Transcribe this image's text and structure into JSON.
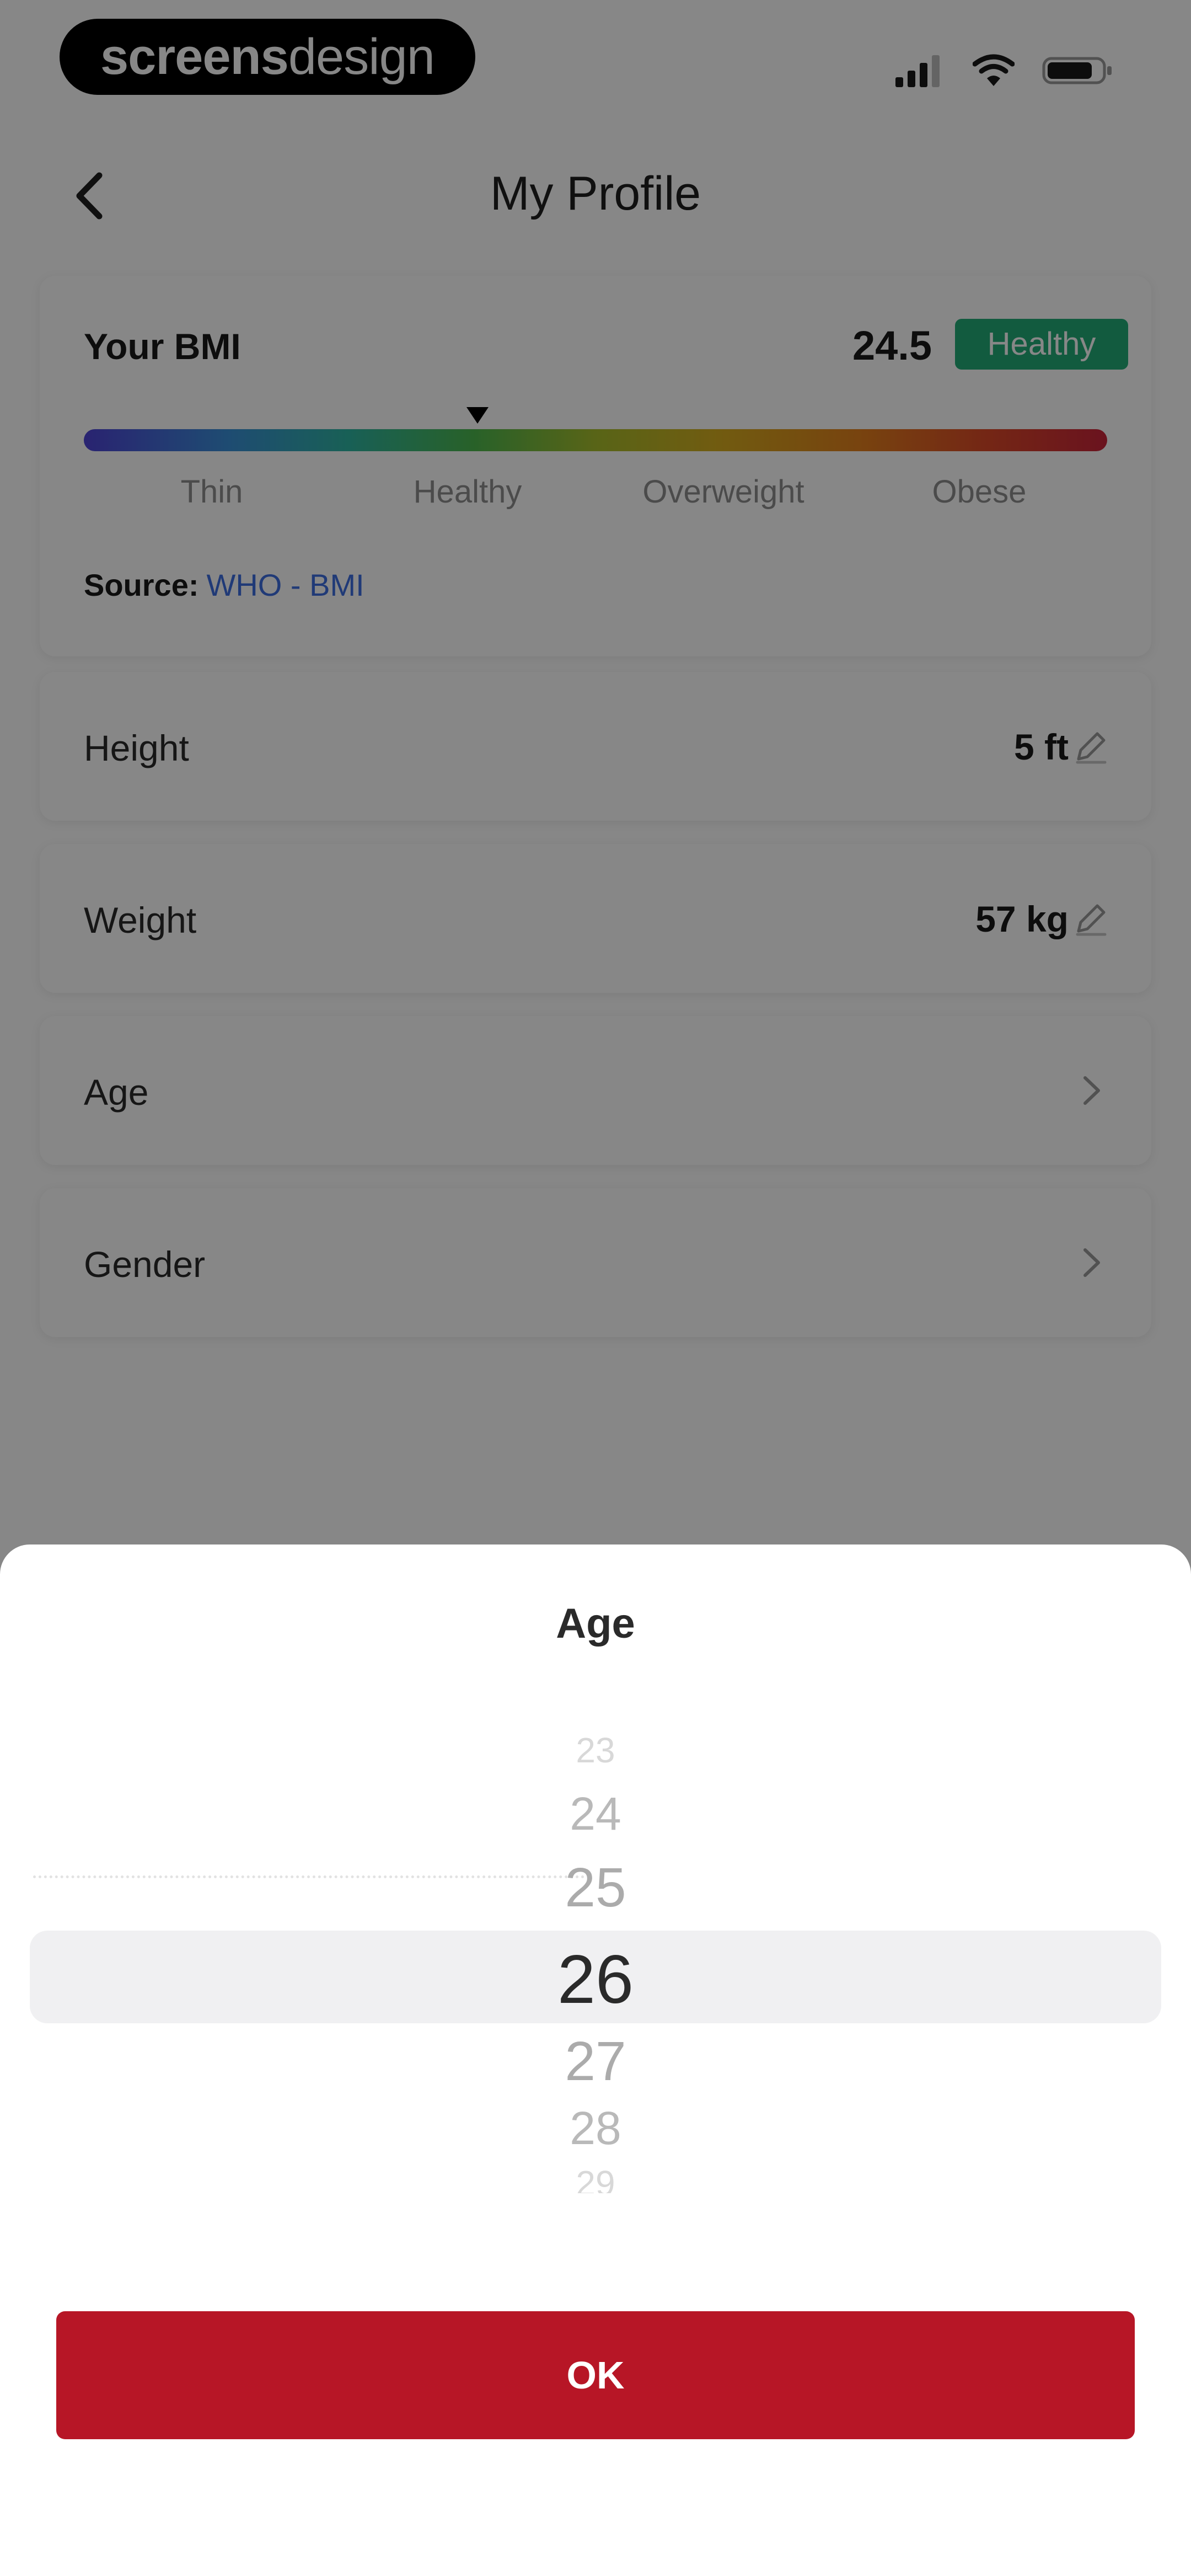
{
  "status_bar": {
    "brand_strong": "screens",
    "brand_light": "design",
    "icons": [
      "signal-icon",
      "wifi-icon",
      "battery-icon"
    ]
  },
  "header": {
    "title": "My Profile",
    "back_icon": "chevron-left-icon"
  },
  "bmi": {
    "label": "Your BMI",
    "value": "24.5",
    "status": "Healthy",
    "status_color": "#23ad78",
    "categories": [
      "Thin",
      "Healthy",
      "Overweight",
      "Obese"
    ],
    "source_label": "Source:",
    "source_link": "WHO - BMI"
  },
  "profile_rows": [
    {
      "label": "Height",
      "value": "5 ft",
      "icon": "pencil-icon"
    },
    {
      "label": "Weight",
      "value": "57 kg",
      "icon": "pencil-icon"
    },
    {
      "label": "Age",
      "value": "",
      "icon": "chevron-right-icon"
    },
    {
      "label": "Gender",
      "value": "",
      "icon": "chevron-right-icon"
    }
  ],
  "age_sheet": {
    "title": "Age",
    "options": [
      "23",
      "24",
      "25",
      "26",
      "27",
      "28",
      "29"
    ],
    "selected": "26",
    "ok_label": "OK",
    "accent_color": "#b71626"
  }
}
